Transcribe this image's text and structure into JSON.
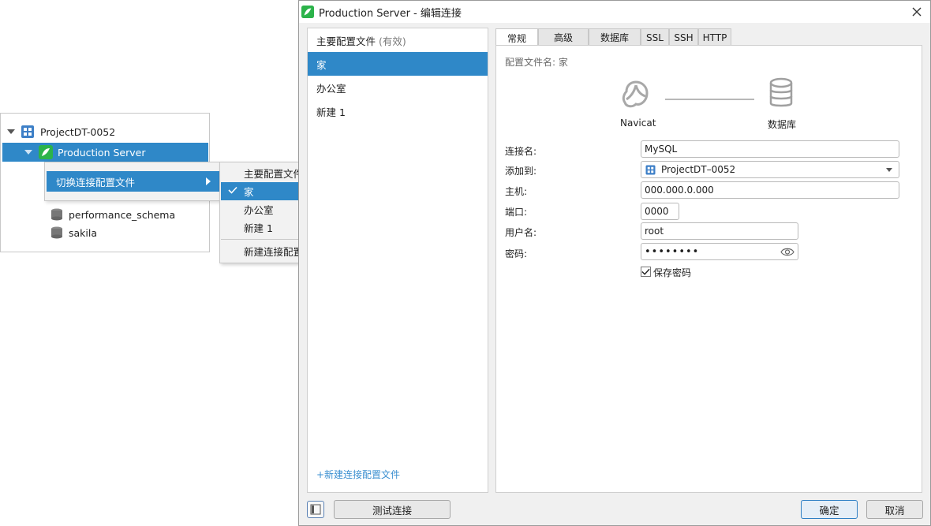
{
  "tree": {
    "project": "ProjectDT-0052",
    "connection": "Production Server",
    "databases": [
      "performance_schema",
      "sakila"
    ]
  },
  "context_menu": {
    "switch_profile": "切换连接配置文件"
  },
  "submenu": {
    "items": [
      "主要配置文件",
      "家",
      "办公室",
      "新建 1"
    ],
    "selected": "家",
    "new_profile": "新建连接配置文件"
  },
  "dialog": {
    "title": "Production Server - 编辑连接",
    "profiles": {
      "header": "主要配置文件",
      "header_note": "(有效)",
      "items": [
        "家",
        "办公室",
        "新建 1"
      ],
      "new_link": "+新建连接配置文件"
    },
    "tabs": [
      "常规",
      "高级",
      "数据库",
      "SSL",
      "SSH",
      "HTTP"
    ],
    "active_tab": "常规",
    "profile_name": "配置文件名: 家",
    "diagram": {
      "left": "Navicat",
      "right": "数据库"
    },
    "form": {
      "connection_name_label": "连接名:",
      "connection_name": "MySQL",
      "add_to_label": "添加到:",
      "add_to": "ProjectDT–0052",
      "host_label": "主机:",
      "host": "000.000.0.000",
      "port_label": "端口:",
      "port": "0000",
      "username_label": "用户名:",
      "username": "root",
      "password_label": "密码:",
      "password": "••••••••",
      "save_password": "保存密码",
      "save_password_checked": true
    },
    "buttons": {
      "test": "测试连接",
      "ok": "确定",
      "cancel": "取消"
    }
  },
  "colors": {
    "selection": "#2f88c8",
    "link": "#3b8fd0",
    "navicat_green": "#2cb34a"
  }
}
